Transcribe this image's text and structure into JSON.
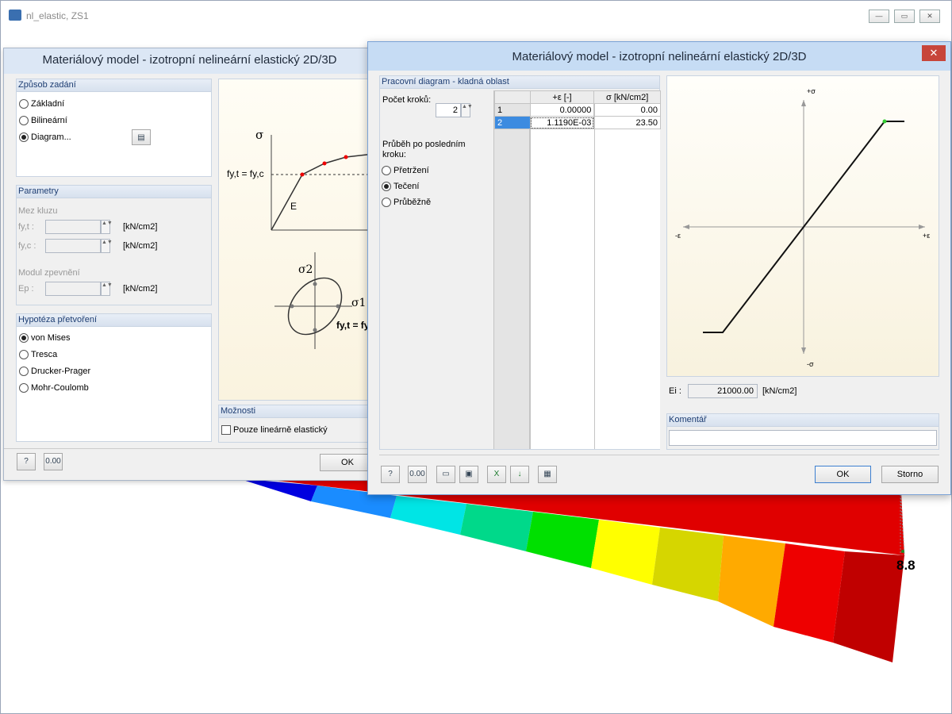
{
  "main_window": {
    "title": "nl_elastic, ZS1",
    "controls": {
      "minimize": "—",
      "maximize": "▭",
      "close": "✕"
    }
  },
  "result_label": "8.8",
  "dialog_left": {
    "title": "Materiálový model - izotropní nelineární elastický 2D/3D",
    "input_method": {
      "header": "Způsob zadání",
      "options": [
        "Základní",
        "Bilineární",
        "Diagram..."
      ],
      "selected": "Diagram..."
    },
    "parameters": {
      "header": "Parametry",
      "yield_label": "Mez kluzu",
      "fyt_label": "fy,t :",
      "fyc_label": "fy,c :",
      "hardening_label": "Modul zpevnění",
      "ep_label": "Ep :",
      "unit1": "[kN/cm2]",
      "unit2": "[kN/cm2]",
      "unit3": "[kN/cm2]",
      "fyt_value": "",
      "fyc_value": "",
      "ep_value": ""
    },
    "hypothesis": {
      "header": "Hypotéza přetvoření",
      "options": [
        "von Mises",
        "Tresca",
        "Drucker-Prager",
        "Mohr-Coulomb"
      ],
      "selected": "von Mises"
    },
    "illustration": {
      "sigma": "σ",
      "fy_label": "fy,t = fy,c",
      "e_label": "E",
      "sigma2": "σ2",
      "sigma1": "σ1",
      "fy_label2": "fy,t = fy"
    },
    "options_group": {
      "header": "Možnosti",
      "linear_only": "Pouze lineárně elastický",
      "linear_only_checked": false
    },
    "ok_label": "OK"
  },
  "dialog_right": {
    "title": "Materiálový model - izotropní nelineární elastický 2D/3D",
    "close_label": "✕",
    "section_header": "Pracovní diagram - kladná oblast",
    "steps_label": "Počet kroků:",
    "steps_value": "2",
    "after_last_label": "Průběh po posledním kroku:",
    "after_last_options": [
      "Přetržení",
      "Tečení",
      "Průběžně"
    ],
    "after_last_selected": "Tečení",
    "table": {
      "col_eps": "+ε [-]",
      "col_sigma": "σ [kN/cm2]",
      "rows": [
        {
          "no": "1",
          "eps": "0.00000",
          "sigma": "0.00"
        },
        {
          "no": "2",
          "eps": "1.1190E-03",
          "sigma": "23.50"
        }
      ]
    },
    "diagram_labels": {
      "pos_sigma": "+σ",
      "neg_sigma": "-σ",
      "neg_eps": "-ε",
      "pos_eps": "+ε"
    },
    "ei_label": "Ei :",
    "ei_value": "21000.00",
    "ei_unit": "[kN/cm2]",
    "comment_header": "Komentář",
    "comment_value": "",
    "ok_label": "OK",
    "cancel_label": "Storno"
  },
  "chart_data": {
    "type": "line",
    "series": [
      {
        "x": [
          -0.001119,
          0,
          0.001119
        ],
        "y": [
          -23.5,
          0,
          23.5
        ]
      }
    ],
    "plateau": "Tečení"
  }
}
